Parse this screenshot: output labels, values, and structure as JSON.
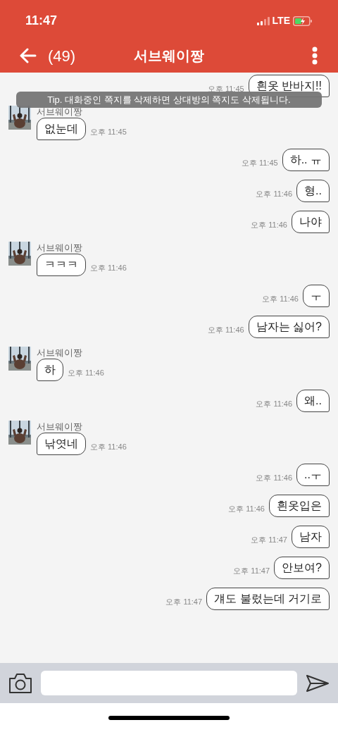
{
  "status_bar": {
    "time": "11:47",
    "network": "LTE"
  },
  "header": {
    "count": "(49)",
    "title": "서브웨이짱"
  },
  "tip": "Tip. 대화중인 쪽지를 삭제하면 상대방의 쪽지도 삭제됩니다.",
  "messages": [
    {
      "kind": "out",
      "text": "흰옷 반바지!!",
      "time": "오후 11:45"
    },
    {
      "kind": "in",
      "sender": "서브웨이짱",
      "text": "없눈데",
      "time": "오후 11:45"
    },
    {
      "kind": "out",
      "text": "하.. ㅠ",
      "time": "오후 11:45"
    },
    {
      "kind": "out",
      "text": "형..",
      "time": "오후 11:46"
    },
    {
      "kind": "out",
      "text": "나야",
      "time": "오후 11:46"
    },
    {
      "kind": "in",
      "sender": "서브웨이짱",
      "text": "ㅋㅋㅋ",
      "time": "오후 11:46"
    },
    {
      "kind": "out",
      "text": "ㅜ",
      "time": "오후 11:46"
    },
    {
      "kind": "out",
      "text": "남자는 싫어?",
      "time": "오후 11:46"
    },
    {
      "kind": "in",
      "sender": "서브웨이짱",
      "text": "하",
      "time": "오후 11:46"
    },
    {
      "kind": "out",
      "text": "왜..",
      "time": "오후 11:46"
    },
    {
      "kind": "in",
      "sender": "서브웨이짱",
      "text": "낚엿네",
      "time": "오후 11:46"
    },
    {
      "kind": "out",
      "text": "..ㅜ",
      "time": "오후 11:46"
    },
    {
      "kind": "out",
      "text": "흰옷입은",
      "time": "오후 11:46"
    },
    {
      "kind": "out",
      "text": "남자",
      "time": "오후 11:47"
    },
    {
      "kind": "out",
      "text": "안보여?",
      "time": "오후 11:47"
    },
    {
      "kind": "out",
      "text": "걔도 불렀는데 거기로",
      "time": "오후 11:47"
    }
  ]
}
